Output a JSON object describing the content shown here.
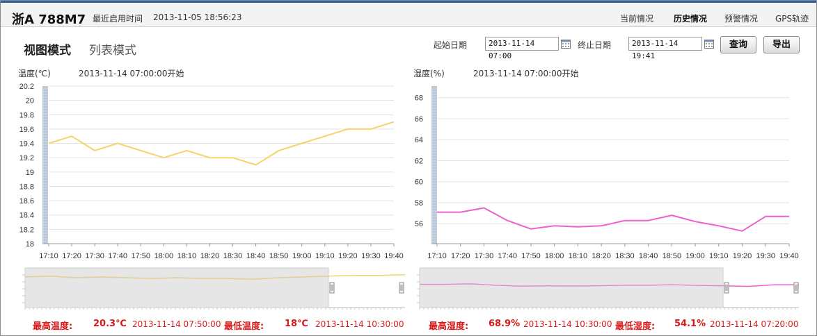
{
  "header": {
    "vehicle": "浙A 788M7",
    "last_used_label": "最近启用时间",
    "last_used_time": "2013-11-05 18:56:23",
    "nav": [
      {
        "label": "当前情况",
        "active": false
      },
      {
        "label": "历史情况",
        "active": true
      },
      {
        "label": "预警情况",
        "active": false
      },
      {
        "label": "GPS轨迹",
        "active": false
      }
    ]
  },
  "toolbar": {
    "view_tabs": [
      {
        "label": "视图模式",
        "active": true
      },
      {
        "label": "列表模式",
        "active": false
      }
    ],
    "start_label": "起始日期",
    "start_value": "2013-11-14 07:00",
    "end_label": "终止日期",
    "end_value": "2013-11-14 19:41",
    "query_label": "查询",
    "export_label": "导出"
  },
  "temp_panel": {
    "axis_title": "温度(℃)",
    "start_text": "2013-11-14 07:00:00开始",
    "stats": {
      "max_label": "最高温度:",
      "max_value": "20.3℃",
      "max_time": "2013-11-14 07:50:00",
      "min_label": "最低温度:",
      "min_value": "18℃",
      "min_time": "2013-11-14 10:30:00"
    }
  },
  "humid_panel": {
    "axis_title": "湿度(%)",
    "start_text": "2013-11-14 07:00:00开始",
    "stats": {
      "max_label": "最高湿度:",
      "max_value": "68.9%",
      "max_time": "2013-11-14 10:30:00",
      "min_label": "最低湿度:",
      "min_value": "54.1%",
      "min_time": "2013-11-14 07:20:00"
    }
  },
  "chart_data": [
    {
      "type": "line",
      "ylabel": "温度(℃)",
      "color": "#f5d36b",
      "ylim": [
        18,
        20.2
      ],
      "yticks": [
        "20.2",
        "20",
        "19.8",
        "19.6",
        "19.4",
        "19.2",
        "19",
        "18.8",
        "18.6",
        "18.4",
        "18.2",
        "18"
      ],
      "x": [
        "17:10",
        "17:20",
        "17:30",
        "17:40",
        "17:50",
        "18:00",
        "18:10",
        "18:20",
        "18:30",
        "18:40",
        "18:50",
        "19:00",
        "19:10",
        "19:20",
        "19:30",
        "19:40"
      ],
      "values": [
        19.4,
        19.5,
        19.3,
        19.4,
        19.3,
        19.2,
        19.3,
        19.2,
        19.2,
        19.1,
        19.3,
        19.4,
        19.5,
        19.6,
        19.6,
        19.7
      ]
    },
    {
      "type": "line",
      "ylabel": "湿度(%)",
      "color": "#ef5fcf",
      "ylim": [
        54.1,
        69.1
      ],
      "yticks": [
        "68",
        "66",
        "64",
        "62",
        "60",
        "58",
        "56"
      ],
      "x": [
        "17:10",
        "17:20",
        "17:30",
        "17:40",
        "17:50",
        "18:00",
        "18:10",
        "18:20",
        "18:30",
        "18:40",
        "18:50",
        "19:00",
        "19:10",
        "19:20",
        "19:30",
        "19:40"
      ],
      "values": [
        57.1,
        57.1,
        57.5,
        56.3,
        55.5,
        55.8,
        55.7,
        55.8,
        56.3,
        56.3,
        56.8,
        56.2,
        55.8,
        55.3,
        56.7,
        56.7
      ]
    }
  ]
}
